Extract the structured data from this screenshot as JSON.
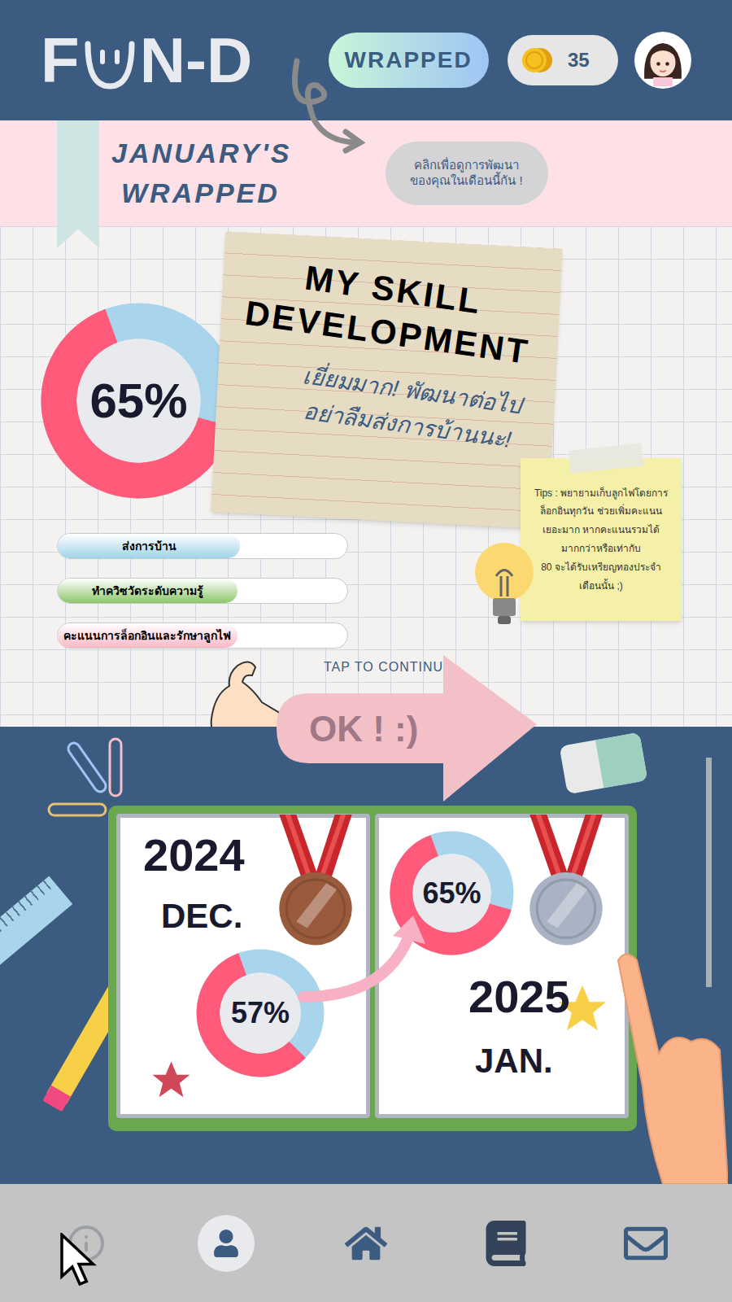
{
  "header": {
    "logo_start": "F",
    "logo_end": "N-D",
    "wrapped_button": "WRAPPED",
    "coins": "35"
  },
  "banner": {
    "title": [
      "JANUARY'S",
      "WRAPPED"
    ],
    "hint": [
      "คลิกเพื่อดูการพัฒนา",
      "ของคุณในเดือนนี้กัน !"
    ]
  },
  "skill": {
    "percent": "65%",
    "level": 0.65,
    "title": [
      "MY SKILL",
      "DEVELOPMENT"
    ],
    "message": [
      "เยี่ยมมาก! พัฒนาต่อไป",
      "อย่าลืมส่งการบ้านนะ!"
    ]
  },
  "tip": [
    "Tips : พยายามเก็บลูกไฟโดยการ",
    "ล็อกอินทุกวัน ช่วยเพิ่มคะแนน",
    "เยอะมาก หากคะแนนรวมได้",
    "มากกว่าหรือเท่ากับ",
    "80 จะได้รับเหรียญทองประจำ",
    "เดือนนั้น ;)"
  ],
  "bars": [
    {
      "label": "ส่งการบ้าน",
      "level": 0.63,
      "color": "#9fd3e8"
    },
    {
      "label": "ทำควิซวัดระดับความรู้",
      "level": 0.62,
      "color": "#8cc66a"
    },
    {
      "label": "คะแนนการล็อกอินและรักษาลูกไฟ",
      "level": 0.62,
      "color": "#f8b9c6"
    }
  ],
  "continue": {
    "hint": "TAP TO CONTINUE",
    "button": "OK ! :)"
  },
  "comparison": [
    {
      "year": "2024",
      "month": "DEC.",
      "percent": "57%",
      "level": 0.57,
      "medal_color": "#9a5a3c"
    },
    {
      "year": "2025",
      "month": "JAN.",
      "percent": "65%",
      "level": 0.65,
      "medal_color": "#a9b3c4"
    }
  ],
  "nav": [
    {
      "kind": "info",
      "selected": false
    },
    {
      "kind": "profile",
      "selected": true
    },
    {
      "kind": "home",
      "selected": false
    },
    {
      "kind": "book",
      "selected": false
    },
    {
      "kind": "mail",
      "selected": false
    }
  ]
}
